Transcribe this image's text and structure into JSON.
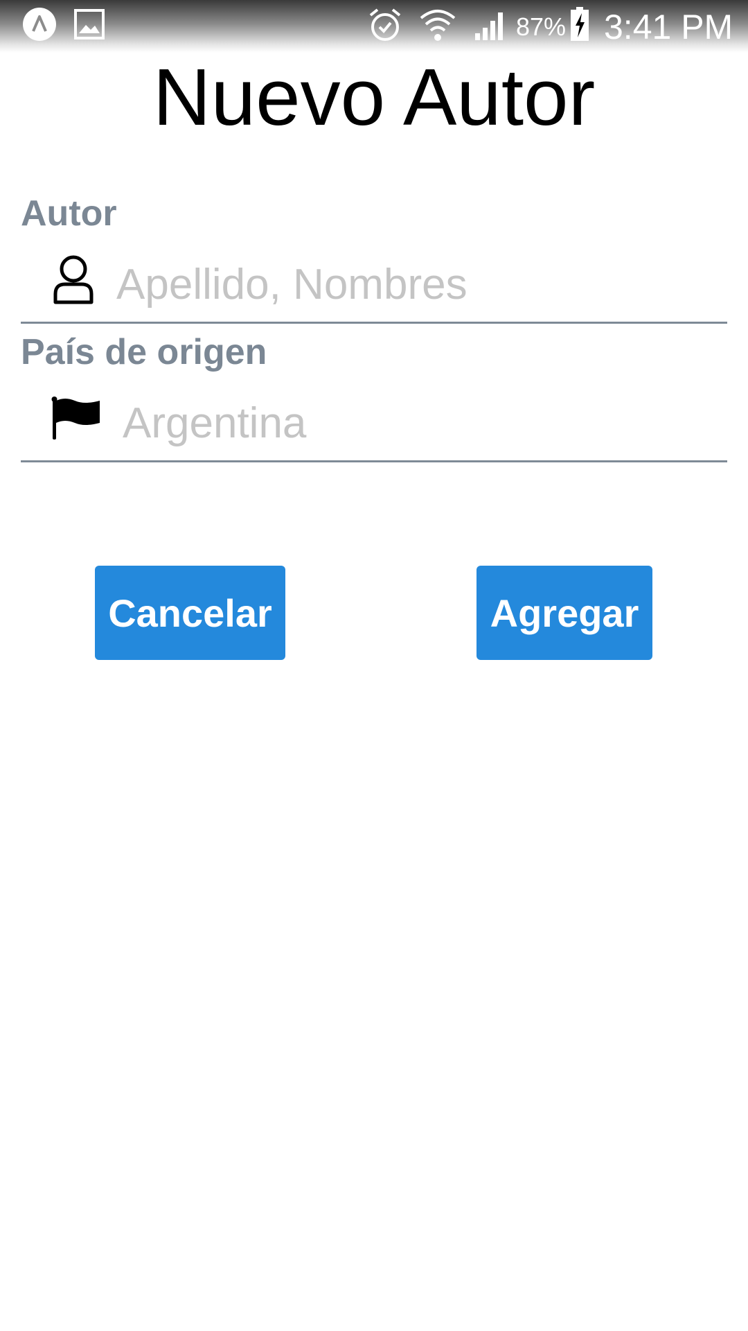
{
  "status_bar": {
    "left_icons": [
      "android-auto-icon",
      "image-icon"
    ],
    "right_icons": [
      "alarm-icon",
      "wifi-icon",
      "signal-icon",
      "battery-charging-icon"
    ],
    "battery_percent": "87%",
    "time": "3:41 PM"
  },
  "page": {
    "title": "Nuevo Autor"
  },
  "form": {
    "author": {
      "label": "Autor",
      "icon": "user-icon",
      "placeholder": "Apellido, Nombres",
      "value": ""
    },
    "country": {
      "label": "País de origen",
      "icon": "flag-icon",
      "placeholder": "Argentina",
      "value": ""
    }
  },
  "buttons": {
    "cancel": "Cancelar",
    "add": "Agregar"
  },
  "colors": {
    "button_bg": "#2489dc",
    "label": "#7b8794",
    "underline": "#7e8a96",
    "placeholder": "#c4c4c4"
  }
}
